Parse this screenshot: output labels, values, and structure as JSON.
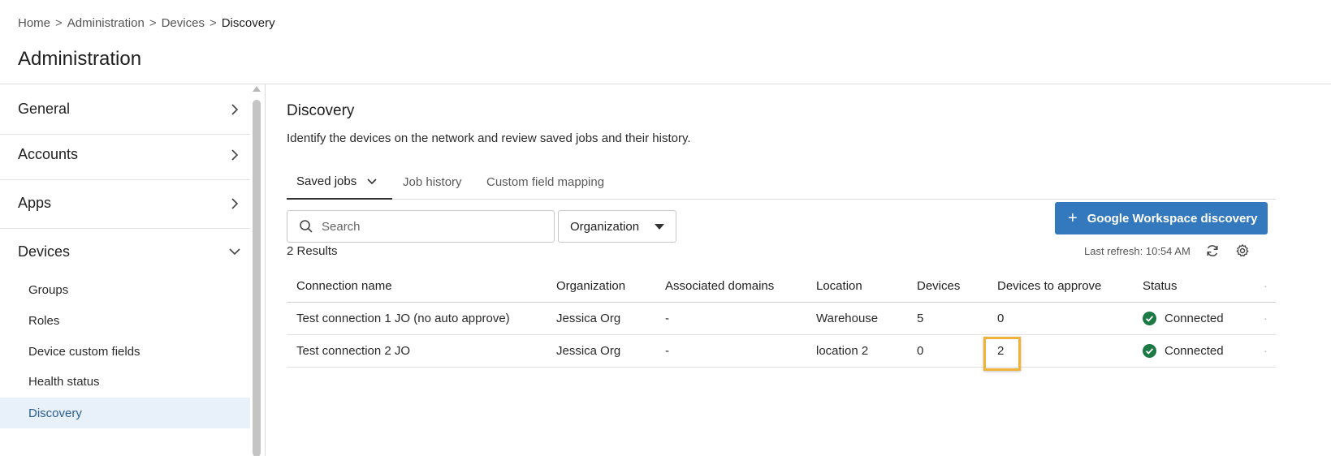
{
  "breadcrumb": {
    "items": [
      "Home",
      "Administration",
      "Devices"
    ],
    "current": "Discovery",
    "separator": ">"
  },
  "page_title": "Administration",
  "sidebar": {
    "sections": [
      {
        "label": "General",
        "expanded": false
      },
      {
        "label": "Accounts",
        "expanded": false
      },
      {
        "label": "Apps",
        "expanded": false
      },
      {
        "label": "Devices",
        "expanded": true
      }
    ],
    "sub_items": [
      "Groups",
      "Roles",
      "Device custom fields",
      "Health status",
      "Discovery"
    ],
    "active_sub_item": "Discovery"
  },
  "main": {
    "title": "Discovery",
    "description": "Identify the devices on the network and review saved jobs and their history.",
    "tabs": [
      {
        "label": "Saved jobs",
        "active": true
      },
      {
        "label": "Job history",
        "active": false
      },
      {
        "label": "Custom field mapping",
        "active": false
      }
    ],
    "search": {
      "placeholder": "Search",
      "value": ""
    },
    "organization_filter": "Organization",
    "primary_button": "Google Workspace discovery",
    "results_count": "2 Results",
    "last_refresh": "Last refresh: 10:54 AM"
  },
  "table": {
    "columns": [
      "Connection name",
      "Organization",
      "Associated domains",
      "Location",
      "Devices",
      "Devices to approve",
      "Status"
    ],
    "rows": [
      [
        "Test connection 1 JO (no auto approve)",
        "Jessica Org",
        "-",
        "Warehouse",
        "5",
        "0",
        "Connected"
      ],
      [
        "Test connection 2 JO",
        "Jessica Org",
        "-",
        "location 2",
        "0",
        "2",
        "Connected"
      ]
    ]
  },
  "colors": {
    "accent": "#3479bd",
    "active_bg": "#e8f0fa",
    "status_connected": "#1e7a45",
    "highlight": "#f0b33a"
  },
  "icons": [
    "chevron-right-icon",
    "chevron-down-icon",
    "search-icon",
    "caret-down-icon",
    "plus-icon",
    "refresh-icon",
    "gear-icon",
    "check-circle-icon"
  ]
}
